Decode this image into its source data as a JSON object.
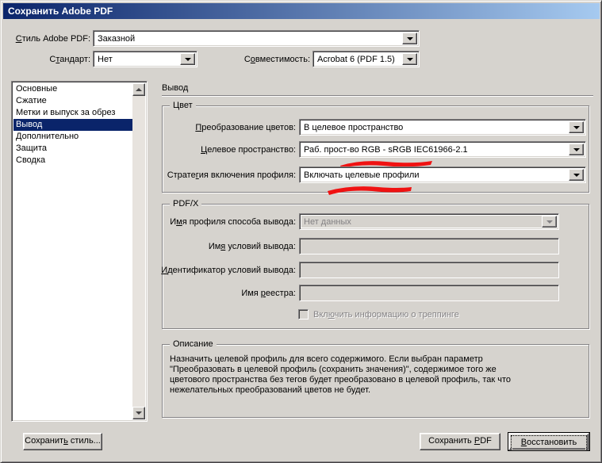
{
  "colors": {
    "titlebar_left": "#0a246a",
    "titlebar_right": "#a6caf0",
    "selection_bg": "#0a246a",
    "annotation_red": "#f01212",
    "window_face": "#d6d3ce"
  },
  "window": {
    "title": "Сохранить Adobe PDF"
  },
  "header": {
    "preset_label": "_Стиль Adobe PDF:",
    "preset_value": "Заказной",
    "standard_label": "С_тандарт:",
    "standard_value": "Нет",
    "compatibility_label": "С_овместимость:",
    "compatibility_value": "Acrobat 6 (PDF 1.5)"
  },
  "sidebar": {
    "items": [
      "Основные",
      "Сжатие",
      "Метки и выпуск за обрез",
      "Вывод",
      "Дополнительно",
      "Защита",
      "Сводка"
    ],
    "selected": "Вывод"
  },
  "panel": {
    "heading": "Вывод",
    "color_group": {
      "title": "Цвет",
      "conversion_label": "_Преобразование цветов:",
      "conversion_value": "В целевое пространство",
      "destination_label": "_Целевое пространство:",
      "destination_value": "Раб. прост-во RGB - sRGB IEC61966-2.1",
      "policy_label": "Страте_гия включения профиля:",
      "policy_value": "Включать целевые профили"
    },
    "pdfx_group": {
      "title": "PDF/X",
      "intent_label": "И_мя профиля способа вывода:",
      "intent_value": "Нет данных",
      "condition_name_label": "Им_я условий вывода:",
      "condition_name_value": "",
      "condition_id_label": "_Идентификатор условий вывода:",
      "condition_id_value": "",
      "registry_label": "Имя _реестра:",
      "registry_value": "",
      "trapping_checkbox_label": "Вкл_ючить информацию о треппинге",
      "trapping_checked": false
    },
    "description_group": {
      "title": "Описание",
      "text": "Назначить целевой профиль для всего содержимого. Если выбран параметр\n\"Преобразовать в целевой профиль (сохранить значения)\", содержимое того же\nцветового пространства без тегов будет преобразовано в целевой профиль, так что\nнежелательных преобразований цветов не будет."
    }
  },
  "footer": {
    "save_preset_label": "Сохранит_ь стиль...",
    "save_pdf_label": "Сохранить _PDF",
    "reset_label": "_Восстановить"
  }
}
